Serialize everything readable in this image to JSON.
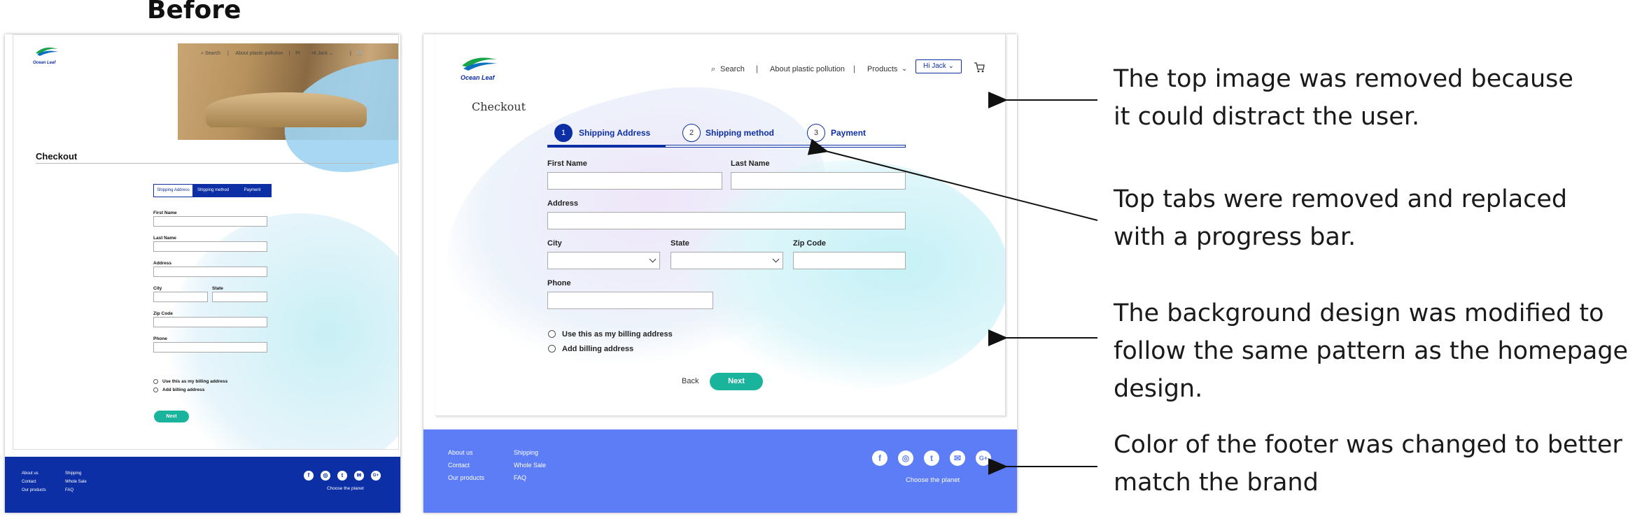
{
  "heading": "Before",
  "before": {
    "nav": {
      "search": "Search",
      "sep1": "|",
      "about": "About plastic pollution",
      "sep2": "|",
      "products": "Pr",
      "user": "Hi Jack",
      "sep3": "|"
    },
    "logo_text": "Ocean Leaf",
    "checkout": "Checkout",
    "tabs": [
      "Shipping Address",
      "Shipping method",
      "Payment"
    ],
    "fields": {
      "first_name": "First Name",
      "last_name": "Last Name",
      "address": "Address",
      "city": "City",
      "state": "State",
      "zip": "Zip Code",
      "phone": "Phone"
    },
    "radios": [
      "Use this as my billing address",
      "Add billing address"
    ],
    "next": "Next",
    "footer": {
      "col1": [
        "About us",
        "Contact",
        "Our products"
      ],
      "col2": [
        "Shipping",
        "Whole Sale",
        "FAQ"
      ],
      "social": [
        "f",
        "◎",
        "t",
        "✉",
        "G+"
      ],
      "tagline": "Choose the planet"
    }
  },
  "after": {
    "logo_text": "Ocean Leaf",
    "nav": {
      "search": "Search",
      "sep1": "|",
      "about": "About plastic pollution",
      "sep2": "|",
      "products": "Products",
      "user": "Hi Jack"
    },
    "checkout": "Checkout",
    "steps": [
      {
        "num": "1",
        "label": "Shipping Address"
      },
      {
        "num": "2",
        "label": "Shipping method"
      },
      {
        "num": "3",
        "label": "Payment"
      }
    ],
    "progress_fraction": 0.33,
    "fields": {
      "first_name": "First Name",
      "last_name": "Last Name",
      "address": "Address",
      "city": "City",
      "state": "State",
      "zip": "Zip Code",
      "phone": "Phone"
    },
    "radios": [
      "Use this as my billing address",
      "Add billing address"
    ],
    "back": "Back",
    "next": "Next",
    "footer": {
      "col1": [
        "About us",
        "Contact",
        "Our products"
      ],
      "col2": [
        "Shipping",
        "Whole Sale",
        "FAQ"
      ],
      "social": [
        "f",
        "◎",
        "t",
        "✉",
        "G+"
      ],
      "tagline": "Choose the planet"
    }
  },
  "annotations": [
    [
      "The top image was removed because",
      "it could distract the user."
    ],
    [
      "Top tabs were removed and replaced",
      "with a progress bar."
    ],
    [
      "The background design was modified to",
      "follow the same pattern as the homepage",
      "design."
    ],
    [
      "Color of the footer was changed to better",
      "match the brand"
    ]
  ],
  "colors": {
    "old_footer": "#0d2fa5",
    "new_footer": "#5c7df5",
    "accent_green": "#1ab39b",
    "brand_blue": "#0d2fa5"
  }
}
